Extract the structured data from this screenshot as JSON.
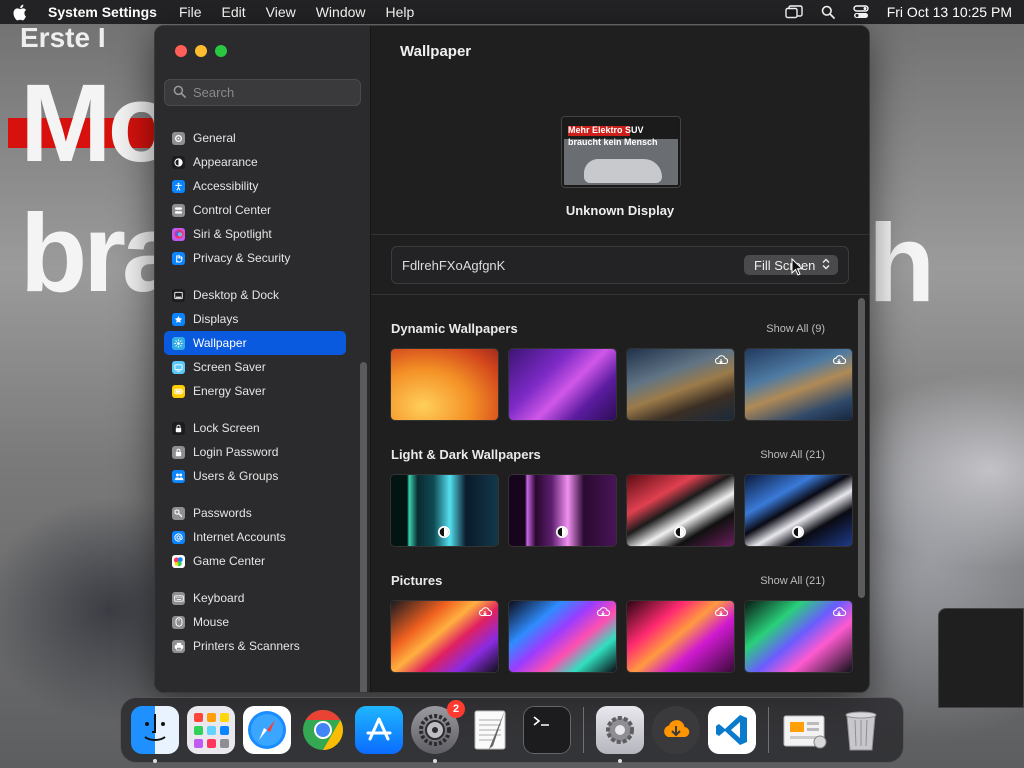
{
  "menubar": {
    "app_name": "System Settings",
    "menus": [
      "File",
      "Edit",
      "View",
      "Window",
      "Help"
    ],
    "clock": "Fri Oct 13  10:25 PM"
  },
  "desktop": {
    "line1": "Mo",
    "line2": "bra",
    "line3": "h",
    "top_text": "Erste I"
  },
  "sidebar": {
    "search_placeholder": "Search",
    "groups": [
      [
        {
          "label": "General",
          "icon": "gear-icon",
          "color": "#8e8e93"
        },
        {
          "label": "Appearance",
          "icon": "appearance-icon",
          "color": "#1c1c1e"
        },
        {
          "label": "Accessibility",
          "icon": "accessibility-icon",
          "color": "#0a84ff"
        },
        {
          "label": "Control Center",
          "icon": "control-center-icon",
          "color": "#8e8e93"
        },
        {
          "label": "Siri & Spotlight",
          "icon": "siri-icon",
          "color": "#bf5af2"
        },
        {
          "label": "Privacy & Security",
          "icon": "hand-icon",
          "color": "#0a84ff"
        }
      ],
      [
        {
          "label": "Desktop & Dock",
          "icon": "dock-icon",
          "color": "#1c1c1e"
        },
        {
          "label": "Displays",
          "icon": "display-icon",
          "color": "#0a84ff"
        },
        {
          "label": "Wallpaper",
          "icon": "wallpaper-icon",
          "color": "#32ade6",
          "active": true
        },
        {
          "label": "Screen Saver",
          "icon": "screen-saver-icon",
          "color": "#5ac8fa"
        },
        {
          "label": "Energy Saver",
          "icon": "battery-icon",
          "color": "#ffcc00"
        }
      ],
      [
        {
          "label": "Lock Screen",
          "icon": "lock-icon",
          "color": "#1c1c1e"
        },
        {
          "label": "Login Password",
          "icon": "lock-icon",
          "color": "#8e8e93"
        },
        {
          "label": "Users & Groups",
          "icon": "users-icon",
          "color": "#0a84ff"
        }
      ],
      [
        {
          "label": "Passwords",
          "icon": "key-icon",
          "color": "#8e8e93"
        },
        {
          "label": "Internet Accounts",
          "icon": "at-icon",
          "color": "#0a84ff"
        },
        {
          "label": "Game Center",
          "icon": "game-center-icon",
          "color": "#ffffff"
        }
      ],
      [
        {
          "label": "Keyboard",
          "icon": "keyboard-icon",
          "color": "#8e8e93"
        },
        {
          "label": "Mouse",
          "icon": "mouse-icon",
          "color": "#8e8e93"
        },
        {
          "label": "Printers & Scanners",
          "icon": "printer-icon",
          "color": "#8e8e93"
        }
      ]
    ]
  },
  "main": {
    "title": "Wallpaper",
    "preview": {
      "line1": "Mehr Elektro SUV",
      "line2": "braucht kein Mensch"
    },
    "display_name": "Unknown Display",
    "wallpaper_name": "FdlrehFXoAgfgnK",
    "fill_mode": "Fill Screen",
    "sections": [
      {
        "title": "Dynamic Wallpapers",
        "show_all": "Show All (9)",
        "thumbs": [
          "t-d1",
          "t-d2",
          "t-d3",
          "t-d4"
        ],
        "download": [
          false,
          false,
          true,
          true
        ],
        "mode": [
          false,
          false,
          false,
          false
        ]
      },
      {
        "title": "Light & Dark Wallpapers",
        "show_all": "Show All (21)",
        "thumbs": [
          "t-l1",
          "t-l2",
          "t-l3",
          "t-l4"
        ],
        "download": [
          false,
          false,
          false,
          false
        ],
        "mode": [
          true,
          true,
          true,
          true
        ]
      },
      {
        "title": "Pictures",
        "show_all": "Show All (21)",
        "thumbs": [
          "t-p1",
          "t-p2",
          "t-p3",
          "t-p4"
        ],
        "download": [
          true,
          true,
          true,
          true
        ],
        "mode": [
          false,
          false,
          false,
          false
        ]
      }
    ]
  },
  "dock": {
    "apps": [
      {
        "name": "finder",
        "running": true
      },
      {
        "name": "launchpad",
        "running": false
      },
      {
        "name": "safari",
        "running": false
      },
      {
        "name": "chrome",
        "running": false
      },
      {
        "name": "app-store",
        "running": false
      },
      {
        "name": "system-settings",
        "running": true,
        "badge": "2"
      },
      {
        "name": "textedit",
        "running": false
      },
      {
        "name": "terminal",
        "running": false
      },
      {
        "name": "settings-utility",
        "running": true
      },
      {
        "name": "downloader",
        "running": false
      },
      {
        "name": "vscode",
        "running": false
      },
      {
        "name": "preview-docs",
        "running": false
      },
      {
        "name": "trash",
        "running": false
      }
    ]
  }
}
